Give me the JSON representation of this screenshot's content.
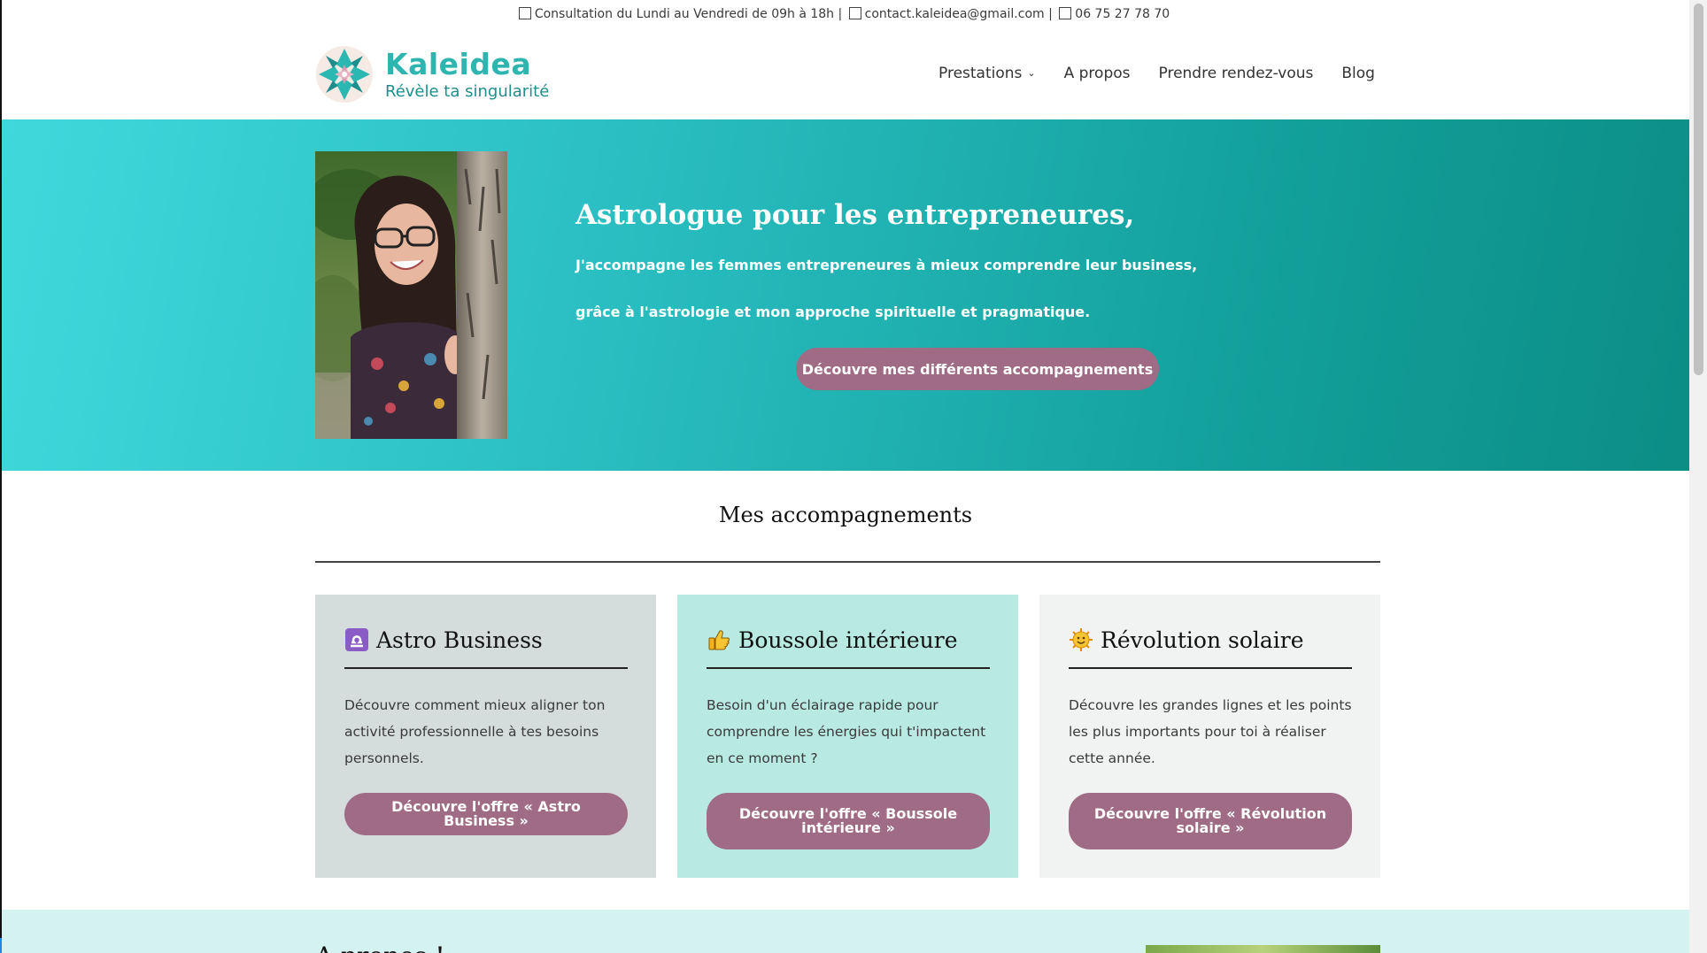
{
  "topbar": {
    "hours": "Consultation du Lundi au Vendredi de 09h à 18h |",
    "email": "contact.kaleidea@gmail.com |",
    "phone": "06 75 27 78 70"
  },
  "header": {
    "brand": "Kaleidea",
    "tagline": "Révèle ta singularité",
    "nav": [
      {
        "label": "Prestations",
        "has_dropdown": true
      },
      {
        "label": "A propos"
      },
      {
        "label": "Prendre rendez-vous"
      },
      {
        "label": "Blog"
      }
    ]
  },
  "hero": {
    "title": "Astrologue pour les entrepreneures,",
    "line1": "J'accompagne les femmes entrepreneures à mieux comprendre leur business,",
    "line2": "grâce à l'astrologie et mon approche spirituelle et pragmatique.",
    "cta": "Découvre mes différents accompagnements"
  },
  "section": {
    "title": "Mes accompagnements",
    "cards": [
      {
        "icon": "libra-symbol-icon",
        "title": "Astro Business",
        "description": "Découvre comment mieux aligner ton activité professionnelle à tes besoins personnels.",
        "button": "Découvre l'offre « Astro Business »"
      },
      {
        "icon": "thumbs-up-icon",
        "title": "Boussole intérieure",
        "description": "Besoin d'un éclairage rapide pour comprendre les énergies qui t'impactent en ce moment ?",
        "button": "Découvre l'offre « Boussole intérieure »"
      },
      {
        "icon": "sun-face-icon",
        "title": "Révolution solaire",
        "description": "Découvre les grandes lignes et les points les plus importants pour toi à réaliser cette année.",
        "button": "Découvre l'offre « Révolution solaire »"
      }
    ]
  },
  "about": {
    "title": "A propos !"
  },
  "colors": {
    "accent": "#a06b84",
    "brand_teal": "#2fb5b0",
    "hero_start": "#3fd9dc",
    "hero_end": "#0c8d86"
  }
}
